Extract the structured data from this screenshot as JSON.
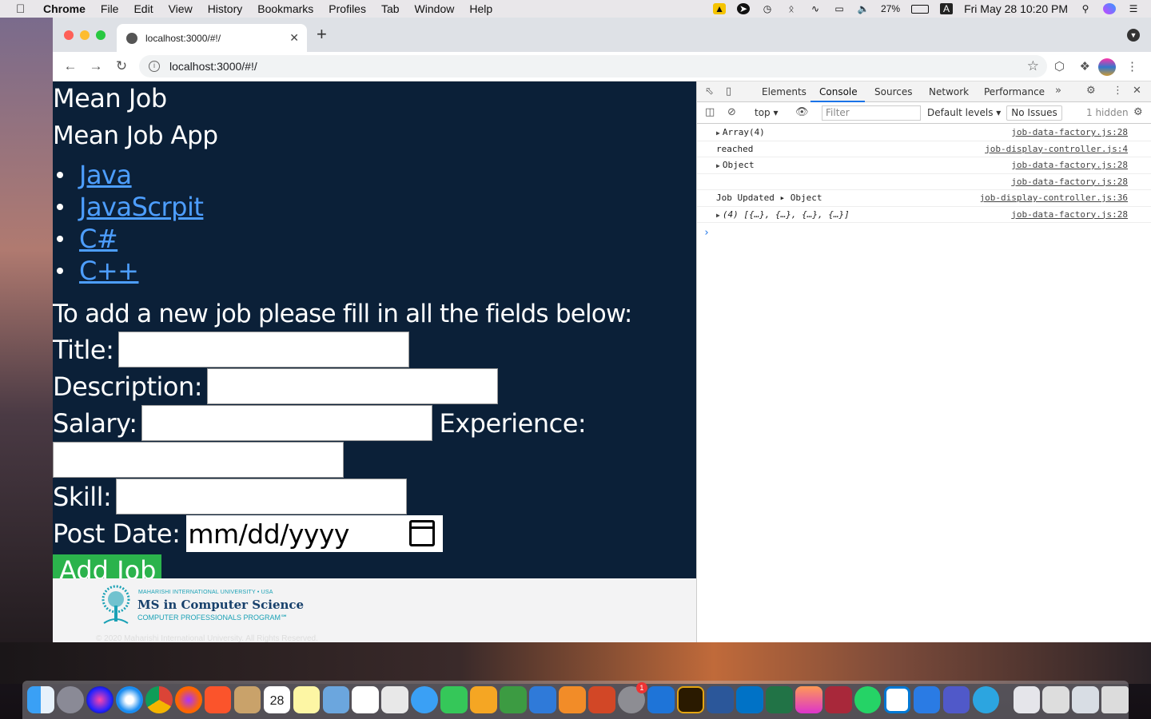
{
  "menubar": {
    "app": "Chrome",
    "items": [
      "File",
      "Edit",
      "View",
      "History",
      "Bookmarks",
      "Profiles",
      "Tab",
      "Window",
      "Help"
    ],
    "battery": "27%",
    "clock": "Fri May 28  10:20 PM",
    "input_letter": "A"
  },
  "browser": {
    "tab_title": "localhost:3000/#!/",
    "url": "localhost:3000/#!/"
  },
  "page": {
    "title": "Mean Job",
    "subtitle": "Mean Job App",
    "jobs": [
      "Java",
      "JavaScrpit",
      "C#",
      "C++"
    ],
    "form_heading": "To add a new job please fill in all the fields below:",
    "labels": {
      "title": "Title:",
      "description": "Description:",
      "salary": "Salary:",
      "experience": "Experience:",
      "skill": "Skill:",
      "post_date": "Post Date:"
    },
    "date_placeholder": "mm/dd/yyyy",
    "add_button": "Add Job",
    "footer": {
      "line1": "MAHARISHI INTERNATIONAL UNIVERSITY • USA",
      "line2": "MS in Computer Science",
      "line3": "COMPUTER PROFESSIONALS PROGRAM℠",
      "copyright": "© 2020 Maharishi International University. All Rights Reserved."
    }
  },
  "devtools": {
    "tabs": [
      "Elements",
      "Console",
      "Sources",
      "Network",
      "Performance"
    ],
    "active_tab": "Console",
    "context": "top",
    "filter_placeholder": "Filter",
    "levels": "Default levels",
    "issues": "No Issues",
    "hidden": "1 hidden",
    "logs": [
      {
        "msg": "Array(4)",
        "expand": true,
        "src": "job-data-factory.js:28"
      },
      {
        "msg": "reached",
        "expand": false,
        "src": "job-display-controller.js:4"
      },
      {
        "msg": "Object",
        "expand": true,
        "src": "job-data-factory.js:28"
      },
      {
        "msg": "",
        "expand": false,
        "src": "job-data-factory.js:28"
      },
      {
        "msg": "Job Updated  ▸ Object",
        "expand": false,
        "src": "job-display-controller.js:36"
      },
      {
        "msg": "(4) [{…}, {…}, {…}, {…}]",
        "expand": true,
        "src": "job-data-factory.js:28"
      }
    ]
  },
  "dock": {
    "calendar_date": "28",
    "badge": "1"
  }
}
